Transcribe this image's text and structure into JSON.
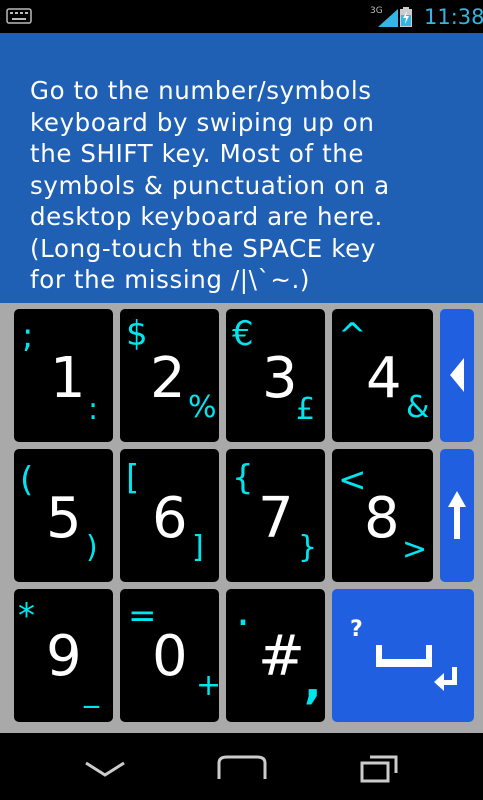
{
  "status_bar": {
    "network": "3G",
    "time": "11:38",
    "icons": [
      "keyboard-icon",
      "signal-icon",
      "battery-charging-icon"
    ],
    "accent_color": "#33b5e5"
  },
  "instruction": {
    "lines": [
      "Go to the number/symbols",
      "keyboard by swiping up on",
      "the SHIFT key. Most of the",
      "symbols & punctuation on a",
      "desktop keyboard are here.",
      "(Long-touch the SPACE key",
      "for the missing /|\\`~.)"
    ],
    "background": "#1f5fb4"
  },
  "keyboard": {
    "keys": [
      {
        "main": "1",
        "upper": ";",
        "lower": ":"
      },
      {
        "main": "2",
        "upper": "$",
        "lower": "%"
      },
      {
        "main": "3",
        "upper": "€",
        "lower": "£"
      },
      {
        "main": "4",
        "upper": "^",
        "lower": "&"
      },
      {
        "main": "5",
        "upper": "(",
        "lower": ")"
      },
      {
        "main": "6",
        "upper": "[",
        "lower": "]"
      },
      {
        "main": "7",
        "upper": "{",
        "lower": "}"
      },
      {
        "main": "8",
        "upper": "<",
        "lower": ">"
      },
      {
        "main": "9",
        "upper": "*",
        "lower": "_"
      },
      {
        "main": "0",
        "upper": "=",
        "lower": "+"
      },
      {
        "main": "#",
        "upper": ".",
        "lower": ","
      }
    ],
    "enter_key": {
      "upper": "?",
      "icons": [
        "space-icon",
        "enter-icon"
      ]
    },
    "side_keys": [
      {
        "icon": "backspace-icon"
      },
      {
        "icon": "shift-arrow-up-icon"
      }
    ],
    "key_color": "#000000",
    "symbol_color": "#00e5ee",
    "action_key_color": "#1f5fe0",
    "background": "#a9a9a9"
  },
  "nav_bar": {
    "buttons": [
      "back-icon",
      "home-icon",
      "recent-apps-icon"
    ]
  }
}
